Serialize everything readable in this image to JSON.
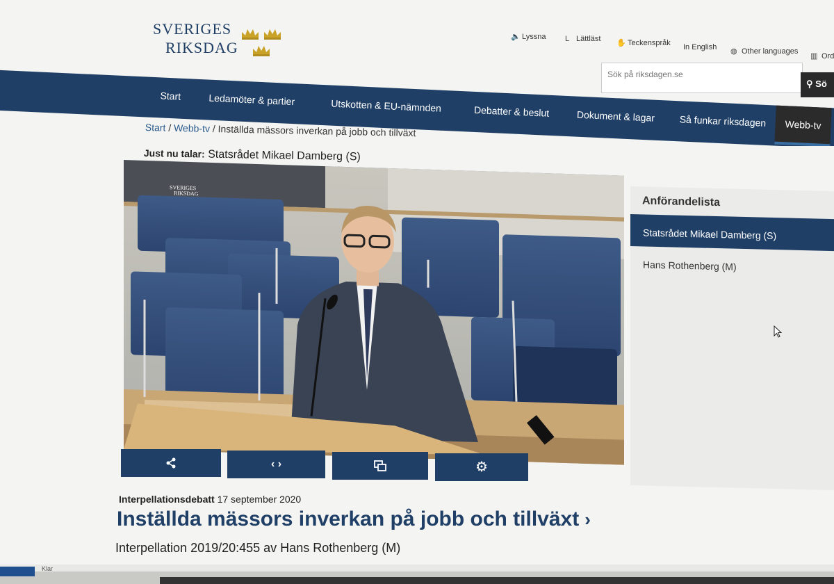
{
  "header": {
    "logo_line1": "SVERIGES",
    "logo_line2": "RIKSDAG",
    "utility": [
      {
        "label": "Lyssna",
        "icon": "speaker-icon"
      },
      {
        "label": "Lättläst",
        "icon": "easy-read-icon"
      },
      {
        "label": "Teckenspråk",
        "icon": "sign-language-icon"
      },
      {
        "label": "In English",
        "icon": ""
      },
      {
        "label": "Other languages",
        "icon": "globe-icon"
      },
      {
        "label": "Ord",
        "icon": "book-icon"
      }
    ],
    "search_placeholder": "Sök på riksdagen.se",
    "search_button": "Sö"
  },
  "nav": {
    "items": [
      "Start",
      "Ledamöter & partier",
      "Utskotten & EU-nämnden",
      "Debatter & beslut",
      "Dokument & lagar",
      "Så funkar riksdagen",
      "Webb-tv"
    ],
    "active": "Webb-tv"
  },
  "breadcrumb": {
    "items": [
      "Start",
      "Webb-tv"
    ],
    "current": "Inställda mässors inverkan på jobb och tillväxt"
  },
  "now_speaking": {
    "label": "Just nu talar:",
    "speaker": "Statsrådet Mikael Damberg (S)"
  },
  "video": {
    "watermark_line1": "SVERIGES",
    "watermark_line2": "RIKSDAG"
  },
  "controls": [
    {
      "name": "share-button",
      "icon": "share-icon"
    },
    {
      "name": "embed-button",
      "icon": "code-icon"
    },
    {
      "name": "popout-button",
      "icon": "popout-icon"
    },
    {
      "name": "settings-button",
      "icon": "gear-icon"
    }
  ],
  "sidebar": {
    "title": "Anförandelista",
    "items": [
      "Statsrådet Mikael Damberg (S)",
      "Hans Rothenberg (M)"
    ],
    "selected": 0
  },
  "debate": {
    "type": "Interpellationsdebatt",
    "date": "17 september 2020",
    "title": "Inställda mässors inverkan på jobb och tillväxt",
    "subtitle": "Interpellation 2019/20:455 av Hans Rothenberg (M)"
  },
  "taskbar": {
    "label": "Klar"
  },
  "colors": {
    "brand": "#1f3f66",
    "gold": "#c9a227"
  }
}
